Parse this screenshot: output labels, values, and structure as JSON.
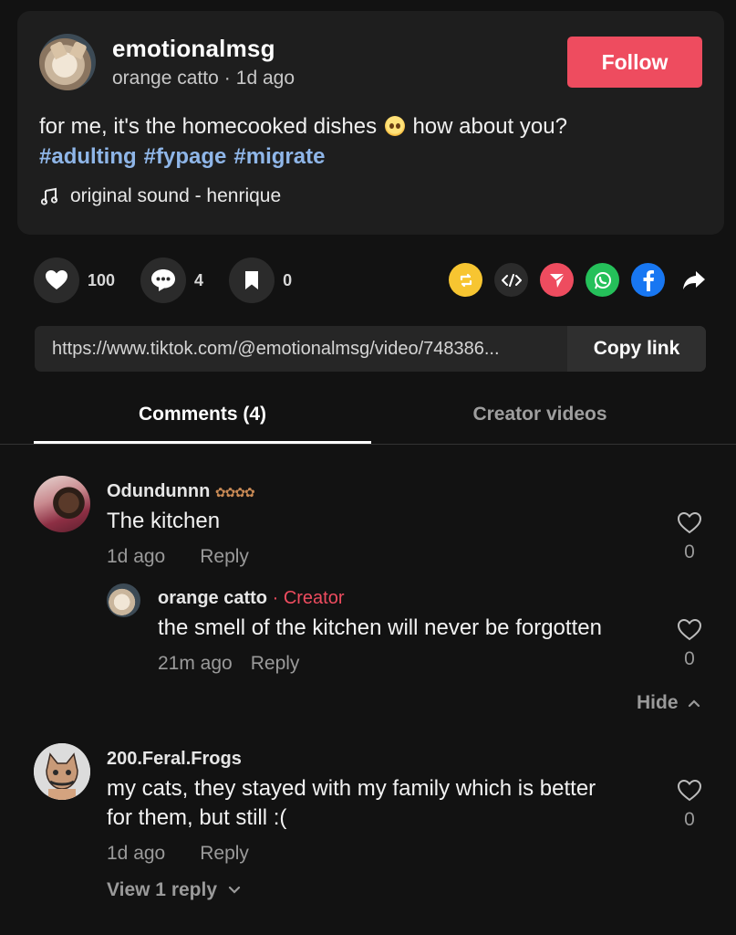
{
  "post": {
    "username": "emotionalmsg",
    "display_name": "orange catto",
    "separator": "·",
    "time": "1d ago",
    "follow_label": "Follow",
    "caption": "for me, it's the homecooked dishes",
    "caption_suffix": "how about you?",
    "hashtags": [
      "#adulting",
      "#fypage",
      "#migrate"
    ],
    "sound": "original sound - henrique"
  },
  "actions": {
    "likes": "100",
    "comments": "4",
    "saves": "0"
  },
  "share_icons": [
    "repost-icon",
    "embed-icon",
    "send-icon",
    "whatsapp-icon",
    "facebook-icon",
    "share-arrow-icon"
  ],
  "link": {
    "url": "https://www.tiktok.com/@emotionalmsg/video/748386...",
    "copy_label": "Copy link"
  },
  "tabs": {
    "comments": "Comments (4)",
    "creator_videos": "Creator videos"
  },
  "comments": [
    {
      "name": "Odundunnn",
      "text": "The kitchen",
      "time": "1d ago",
      "reply": "Reply",
      "likes": "0"
    },
    {
      "name": "200.Feral.Frogs",
      "text_line1": "my cats, they stayed with my family which is better",
      "text_line2": "for them, but still :(",
      "time": "1d ago",
      "reply": "Reply",
      "likes": "0",
      "view_replies": "View 1 reply"
    }
  ],
  "reply": {
    "name": "orange catto",
    "separator": "·",
    "creator_label": "Creator",
    "text": "the smell of the kitchen will never be forgotten",
    "time": "21m ago",
    "reply": "Reply",
    "likes": "0",
    "hide_label": "Hide"
  },
  "colors": {
    "accent": "#ee4c5f",
    "hashtag": "#8fb6e8",
    "background": "#121212",
    "card": "#1e1e1e"
  }
}
